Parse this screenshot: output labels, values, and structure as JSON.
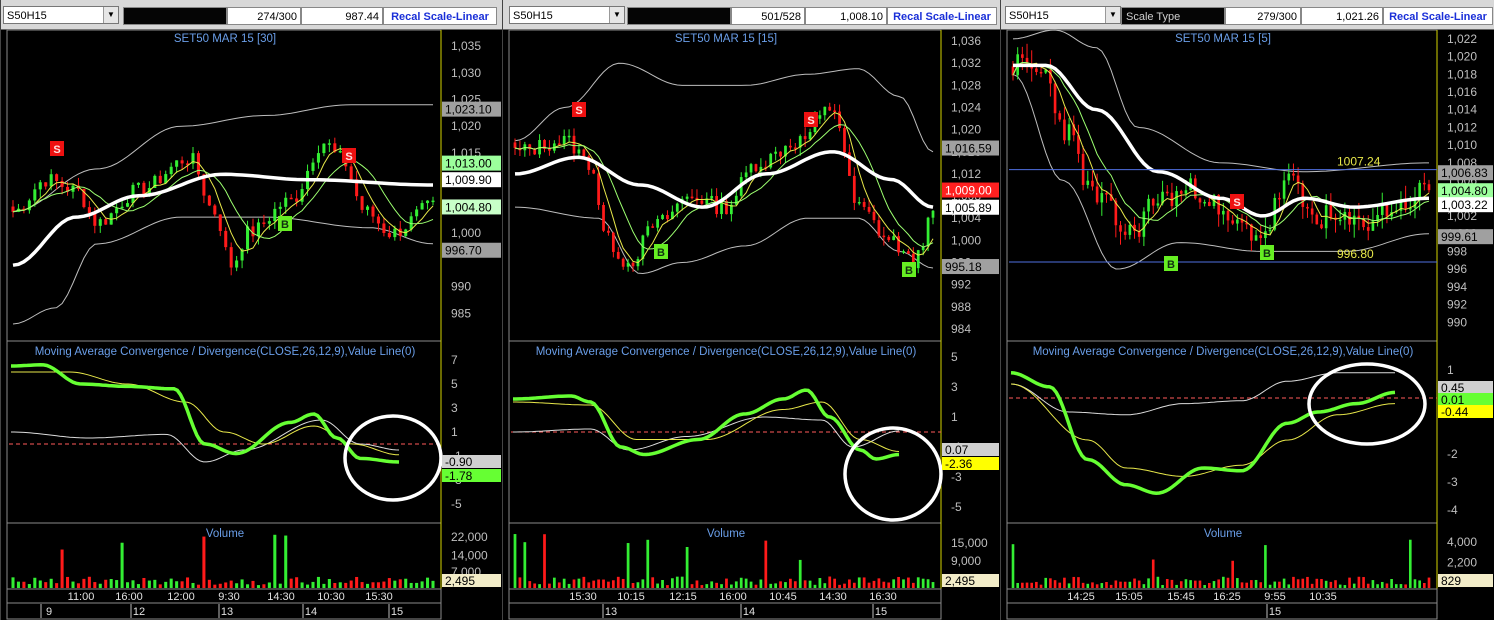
{
  "panels": [
    {
      "symbol": "S50H15",
      "counter": "274/300",
      "last_value": "987.44",
      "scale_label": "",
      "recal_label": "Recal Scale-Linear",
      "chart_title": "SET50 MAR 15  [30]",
      "price_ticks": [
        "1,035",
        "1,030",
        "1,025",
        "1,020",
        "1,015",
        "1,010",
        "1,005",
        "1,000",
        "990",
        "985"
      ],
      "price_tags": [
        {
          "text": "1,023.10",
          "color": "#a0a0a0",
          "value": 1023.1
        },
        {
          "text": "1,013.00",
          "color": "#9cff9c",
          "value": 1013.0
        },
        {
          "text": "1,009.90",
          "color": "#ffffff",
          "value": 1009.9
        },
        {
          "text": "1,004.80",
          "color": "#c8ffc8",
          "value": 1004.8
        },
        {
          "text": "996.70",
          "color": "#a0a0a0",
          "value": 996.7
        }
      ],
      "markers": [
        "S",
        "S",
        "B"
      ],
      "macd_title": "Moving Average Convergence / Divergence(CLOSE,26,12,9),Value Line(0)",
      "macd_ticks": [
        "7",
        "5",
        "3",
        "1",
        "-1",
        "-3",
        "-5"
      ],
      "macd_tags": [
        {
          "text": "-0.90",
          "color": "#d0d0d0"
        },
        {
          "text": "-1.78",
          "color": "#66ff33"
        }
      ],
      "volume_title": "Volume",
      "volume_ticks": [
        "22,000",
        "14,000",
        "7,000"
      ],
      "volume_tag": "2,495",
      "time_labels": [
        "11:00",
        "16:00",
        "12:00",
        "9:30",
        "14:30",
        "10:30",
        "15:30"
      ],
      "date_labels": [
        "9",
        "12",
        "13",
        "14",
        "15"
      ]
    },
    {
      "symbol": "S50H15",
      "counter": "501/528",
      "last_value": "1,008.10",
      "scale_label": "",
      "recal_label": "Recal Scale-Linear",
      "chart_title": "SET50 MAR 15  [15]",
      "price_ticks": [
        "1,036",
        "1,032",
        "1,028",
        "1,024",
        "1,020",
        "1,016",
        "1,012",
        "1,008",
        "1,004",
        "1,000",
        "996",
        "992",
        "988",
        "984"
      ],
      "price_tags": [
        {
          "text": "1,016.59",
          "color": "#a0a0a0",
          "value": 1016.59
        },
        {
          "text": "1,009.00",
          "color": "#ff2020",
          "value": 1009.0
        },
        {
          "text": "1,005.89",
          "color": "#ffffff",
          "value": 1005.89
        },
        {
          "text": "995.18",
          "color": "#a0a0a0",
          "value": 995.18
        }
      ],
      "markers": [
        "S",
        "S",
        "B",
        "B"
      ],
      "macd_title": "Moving Average Convergence / Divergence(CLOSE,26,12,9),Value Line(0)",
      "macd_ticks": [
        "5",
        "3",
        "1",
        "-1",
        "-3",
        "-5"
      ],
      "macd_tags": [
        {
          "text": "0.07",
          "color": "#d0d0d0"
        },
        {
          "text": "-2.36",
          "color": "#ffff00"
        }
      ],
      "volume_title": "Volume",
      "volume_ticks": [
        "15,000",
        "9,000"
      ],
      "volume_tag": "2,495",
      "time_labels": [
        "15:30",
        "10:15",
        "12:15",
        "16:00",
        "10:45",
        "14:30",
        "16:30"
      ],
      "date_labels": [
        "13",
        "14",
        "15"
      ]
    },
    {
      "symbol": "S50H15",
      "counter": "279/300",
      "last_value": "1,021.26",
      "scale_label": "Scale Type",
      "recal_label": "Recal Scale-Linear",
      "chart_title": "SET50 MAR 15  [5]",
      "price_ticks": [
        "1,022",
        "1,020",
        "1,018",
        "1,016",
        "1,014",
        "1,012",
        "1,010",
        "1,008",
        "1,006",
        "1,004",
        "1,002",
        "1,000",
        "998",
        "996",
        "994",
        "992",
        "990"
      ],
      "price_tags": [
        {
          "text": "1,006.83",
          "color": "#a0a0a0",
          "value": 1006.83
        },
        {
          "text": "1,004.80",
          "color": "#9cff9c",
          "value": 1004.8
        },
        {
          "text": "1,003.22",
          "color": "#ffffff",
          "value": 1003.22
        },
        {
          "text": "999.61",
          "color": "#a0a0a0",
          "value": 999.61
        }
      ],
      "levels": [
        {
          "text": "1007.24",
          "value": 1007.24
        },
        {
          "text": "996.80",
          "value": 996.8
        }
      ],
      "markers": [
        "S",
        "B",
        "B"
      ],
      "macd_title": "Moving Average Convergence / Divergence(CLOSE,26,12,9),Value Line(0)",
      "macd_ticks": [
        "1",
        "-2",
        "-3",
        "-4"
      ],
      "macd_tags": [
        {
          "text": "0.45",
          "color": "#d0d0d0"
        },
        {
          "text": "0.01",
          "color": "#66ff33"
        },
        {
          "text": "-0.44",
          "color": "#ffff00"
        }
      ],
      "volume_title": "Volume",
      "volume_ticks": [
        "4,000",
        "2,200"
      ],
      "volume_tag": "829",
      "time_labels": [
        "14:25",
        "15:05",
        "15:45",
        "16:25",
        "9:55",
        "10:35"
      ],
      "date_labels": [
        "15"
      ]
    }
  ],
  "colors": {
    "up": "#33ee33",
    "down": "#ff1a1a",
    "ma_long": "#ffffff",
    "macd": "#66ff33",
    "signal": "#e8e84a",
    "band": "#bdbdbd",
    "title": "#6a9ee8"
  }
}
